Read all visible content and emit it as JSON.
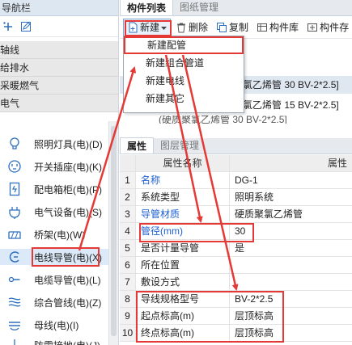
{
  "nav": {
    "title": "导航栏",
    "sections": [
      "轴线",
      "给排水",
      "采暖燃气",
      "电气"
    ],
    "items": [
      {
        "label": "照明灯具(电)(D)",
        "icon": "bulb-icon"
      },
      {
        "label": "开关插座(电)(K)",
        "icon": "socket-icon"
      },
      {
        "label": "配电箱柜(电)(P)",
        "icon": "distribution-box-icon"
      },
      {
        "label": "电气设备(电)(S)",
        "icon": "plug-icon"
      },
      {
        "label": "桥架(电)(W)",
        "icon": "bridge-icon"
      },
      {
        "label": "电线导管(电)(X)",
        "icon": "conduit-icon"
      },
      {
        "label": "电缆导管(电)(L)",
        "icon": "cable-icon"
      },
      {
        "label": "综合管线(电)(Z)",
        "icon": "combined-lines-icon"
      },
      {
        "label": "母线(电)(I)",
        "icon": "busbar-icon"
      },
      {
        "label": "防雷接地(电)(J)",
        "icon": "grounding-icon"
      }
    ]
  },
  "component": {
    "tabs": [
      "构件列表",
      "图纸管理"
    ],
    "toolbar": {
      "new": "新建",
      "delete": "删除",
      "copy": "复制",
      "library": "构件库",
      "more": "构件存"
    },
    "menu": [
      "新建配管",
      "新建组合管道",
      "新建电线",
      "新建其它"
    ],
    "rows": [
      "氯乙烯管 30 BV-2*2.5]",
      "氯乙烯管 15 BV-2*2.5]",
      "(硬质聚氯乙烯管 30 BV-2*2.5]"
    ]
  },
  "properties": {
    "tabs": [
      "属性",
      "图层管理"
    ],
    "headers": {
      "name": "属性名称",
      "value": "属性"
    },
    "rows": [
      {
        "index": "1",
        "name": "名称",
        "value": "DG-1"
      },
      {
        "index": "2",
        "name": "系统类型",
        "value": "照明系统"
      },
      {
        "index": "3",
        "name": "导管材质",
        "value": "硬质聚氯乙烯管"
      },
      {
        "index": "4",
        "name": "管径(mm)",
        "value": "30"
      },
      {
        "index": "5",
        "name": "是否计量导管",
        "value": "是"
      },
      {
        "index": "6",
        "name": "所在位置",
        "value": ""
      },
      {
        "index": "7",
        "name": "敷设方式",
        "value": ""
      },
      {
        "index": "8",
        "name": "导线规格型号",
        "value": "BV-2*2.5"
      },
      {
        "index": "9",
        "name": "起点标高(m)",
        "value": "层顶标高"
      },
      {
        "index": "10",
        "name": "终点标高(m)",
        "value": "层顶标高"
      }
    ]
  },
  "colors": {
    "annotation": "#e53935",
    "link_blue": "#1d5fd1",
    "selection": "#dbe9f8"
  }
}
